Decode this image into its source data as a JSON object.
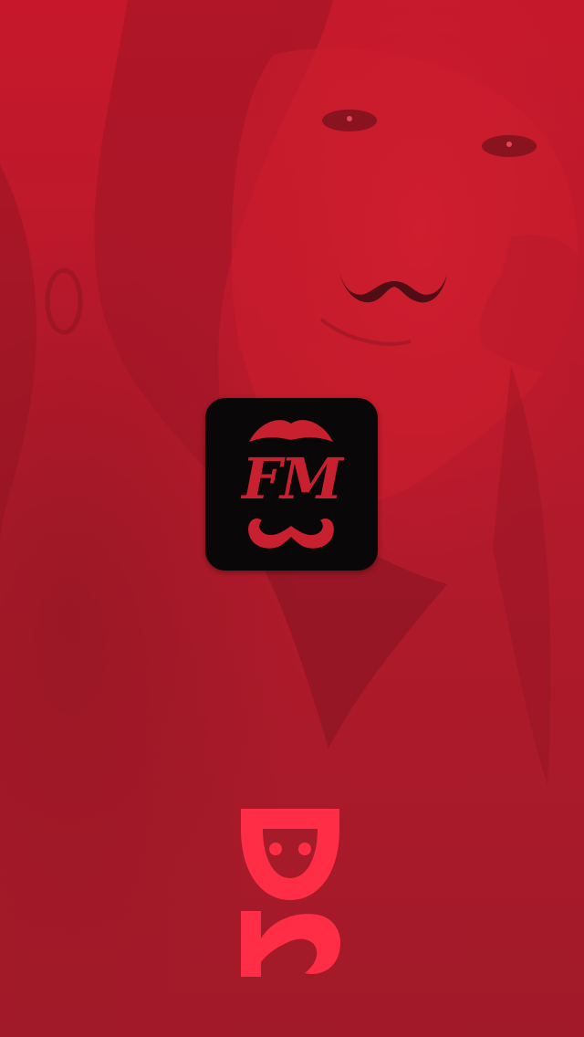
{
  "screen": {
    "type": "splash-screen",
    "background_tint": "#a51b2a",
    "overlay_color": "#c51d2c"
  },
  "app_icon": {
    "lettering": "FM",
    "background_color": "#0a0708",
    "accent_color": "#c8202f",
    "top_icon": "lips-mustache-icon",
    "bottom_icon": "curly-mustache-icon"
  },
  "brand_mark": {
    "text": "DK",
    "color": "#ff2d46",
    "orientation": "rotated-90"
  }
}
